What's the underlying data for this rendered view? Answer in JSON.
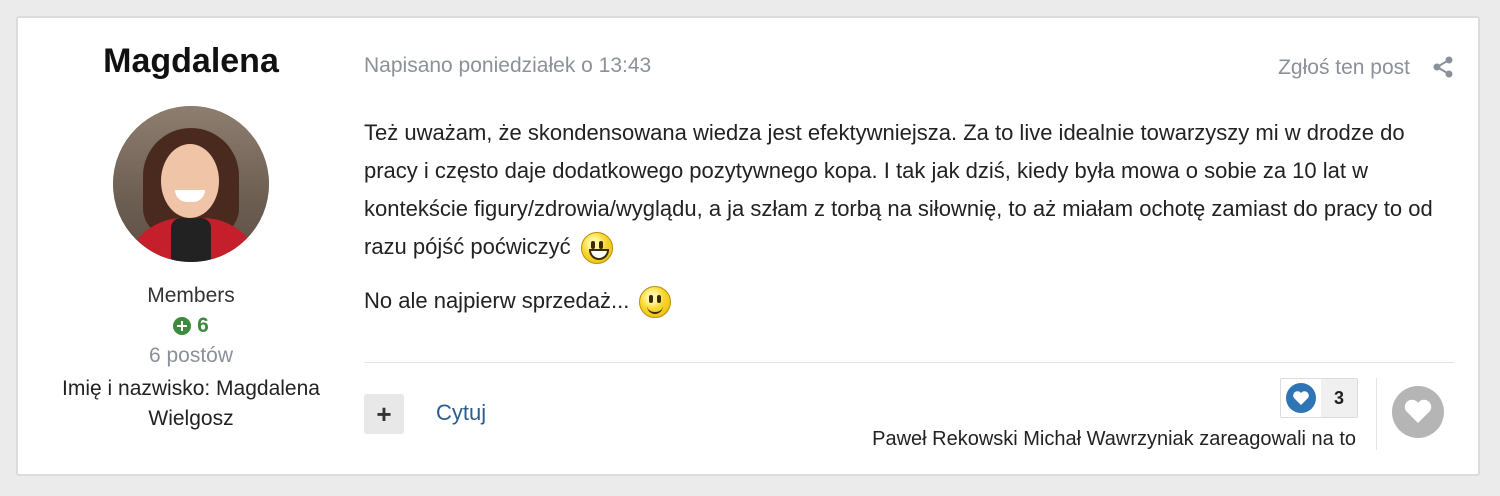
{
  "author": {
    "name": "Magdalena",
    "group": "Members",
    "reputation": "6",
    "post_count": "6 postów",
    "full_name": "Imię i nazwisko: Magdalena Wielgosz"
  },
  "post": {
    "meta": "Napisano poniedziałek o 13:43",
    "report_label": "Zgłoś ten post",
    "share_icon": "share-icon",
    "paragraph_1": "Też uważam, że skondensowana wiedza jest efektywniejsza. Za to live idealnie towarzyszy mi w drodze do pracy i często daje dodatkowego pozytywnego kopa. I tak jak dziś, kiedy była mowa o sobie za 10 lat w kontekście figury/zdrowia/wyglądu, a ja szłam z torbą na siłownię, to aż miałam ochotę zamiast do pracy to od razu pójść poćwiczyć",
    "paragraph_2": "No ale najpierw sprzedaż...",
    "emoji_1": "grinning-emoji",
    "emoji_2": "smile-emoji"
  },
  "actions": {
    "plus_label": "+",
    "quote_label": "Cytuj",
    "reaction_count": "3",
    "reacted_by": "Paweł Rekowski Michał Wawrzyniak zareagowali na to"
  },
  "colors": {
    "accent": "#2f74b5",
    "reputation": "#3e8a3e",
    "muted": "#8b9199"
  }
}
